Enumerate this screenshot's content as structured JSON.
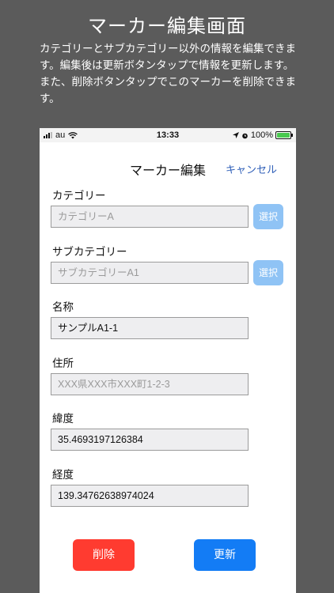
{
  "promo": {
    "title": "マーカー編集画面",
    "description": "カテゴリーとサブカテゴリー以外の情報を編集できます。編集後は更新ボタンタップで情報を更新します。また、削除ボタンタップでこのマーカーを削除できます。"
  },
  "status_bar": {
    "carrier": "au",
    "time": "13:33",
    "battery": "100%",
    "icons": [
      "signal-icon",
      "wifi-icon",
      "location-icon",
      "alarm-icon",
      "battery-charging-icon"
    ]
  },
  "nav": {
    "title": "マーカー編集",
    "cancel": "キャンセル"
  },
  "form": {
    "category": {
      "label": "カテゴリー",
      "value": "カテゴリーA",
      "select": "選択"
    },
    "subcategory": {
      "label": "サブカテゴリー",
      "value": "サブカテゴリーA1",
      "select": "選択"
    },
    "name": {
      "label": "名称",
      "value": "サンプルA1-1"
    },
    "address": {
      "label": "住所",
      "placeholder": "XXX県XXX市XXX町1-2-3"
    },
    "latitude": {
      "label": "緯度",
      "value": "35.4693197126384"
    },
    "longitude": {
      "label": "経度",
      "value": "139.34762638974024"
    }
  },
  "actions": {
    "delete": "削除",
    "update": "更新"
  },
  "colors": {
    "background": "#5b5b5b",
    "link": "#2f5fb8",
    "select_button": "#8fc3f5",
    "delete_button": "#ff3b30",
    "update_button": "#137cf5"
  }
}
